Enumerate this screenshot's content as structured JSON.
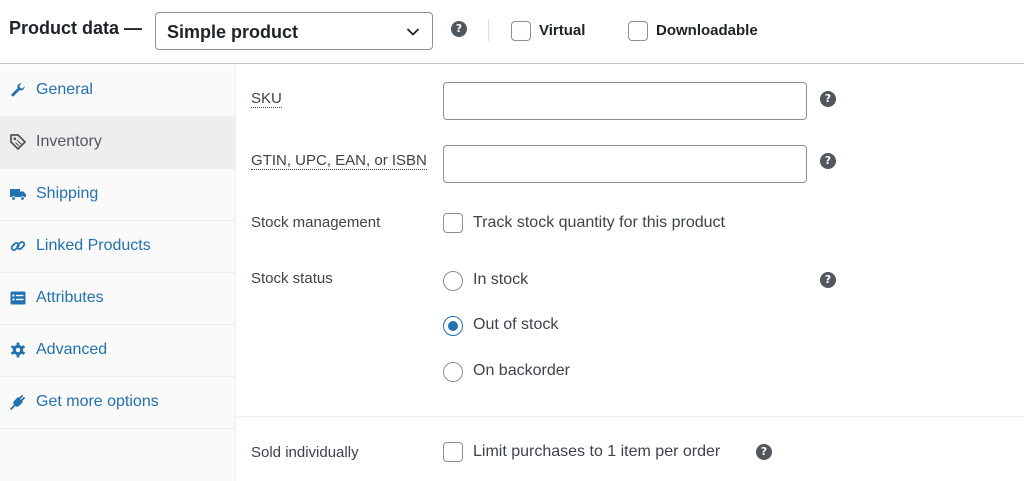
{
  "header": {
    "title": "Product data —",
    "product_type": "Simple product",
    "virtual_label": "Virtual",
    "downloadable_label": "Downloadable",
    "help_glyph": "?"
  },
  "sidebar": {
    "items": [
      {
        "label": "General",
        "icon": "wrench-icon",
        "active": false
      },
      {
        "label": "Inventory",
        "icon": "tag-icon",
        "active": true
      },
      {
        "label": "Shipping",
        "icon": "truck-icon",
        "active": false
      },
      {
        "label": "Linked Products",
        "icon": "link-icon",
        "active": false
      },
      {
        "label": "Attributes",
        "icon": "list-icon",
        "active": false
      },
      {
        "label": "Advanced",
        "icon": "gear-icon",
        "active": false
      },
      {
        "label": "Get more options",
        "icon": "plug-icon",
        "active": false
      }
    ]
  },
  "inventory": {
    "sku_label": "SKU",
    "sku_value": "",
    "gtin_label": "GTIN, UPC, EAN, or ISBN",
    "gtin_value": "",
    "stock_management_label": "Stock management",
    "track_stock_label": "Track stock quantity for this product",
    "track_stock_checked": false,
    "stock_status_label": "Stock status",
    "stock_status_options": [
      "In stock",
      "Out of stock",
      "On backorder"
    ],
    "stock_status_selected": "Out of stock",
    "sold_individually_label": "Sold individually",
    "limit_purchases_label": "Limit purchases to 1 item per order",
    "limit_purchases_checked": false
  },
  "colors": {
    "link": "#2271b1",
    "text": "#1d2327",
    "muted": "#50575e",
    "border": "#8c8f94",
    "sidebar_bg": "#fafafa",
    "active_tab_bg": "#eeeeee"
  }
}
